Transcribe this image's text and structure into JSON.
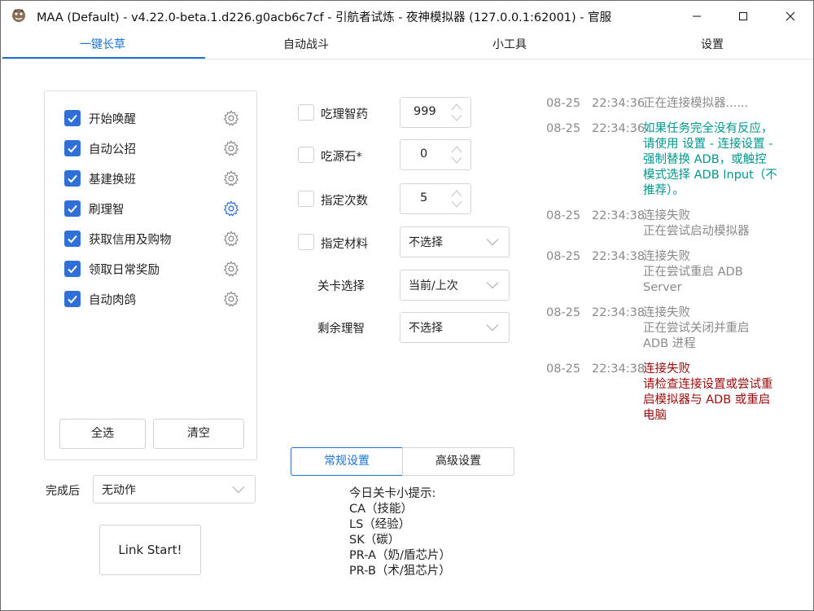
{
  "window": {
    "title": "MAA (Default) - v4.22.0-beta.1.d226.g0acb6c7cf - 引航者试炼 - 夜神模拟器 (127.0.0.1:62001) - 官服"
  },
  "tabs": [
    {
      "label": "一键长草",
      "active": true
    },
    {
      "label": "自动战斗",
      "active": false
    },
    {
      "label": "小工具",
      "active": false
    },
    {
      "label": "设置",
      "active": false
    }
  ],
  "tasks": {
    "items": [
      {
        "label": "开始唤醒",
        "checked": true,
        "gear_active": false
      },
      {
        "label": "自动公招",
        "checked": true,
        "gear_active": false
      },
      {
        "label": "基建换班",
        "checked": true,
        "gear_active": false
      },
      {
        "label": "刷理智",
        "checked": true,
        "gear_active": true
      },
      {
        "label": "获取信用及购物",
        "checked": true,
        "gear_active": false
      },
      {
        "label": "领取日常奖励",
        "checked": true,
        "gear_active": false
      },
      {
        "label": "自动肉鸽",
        "checked": true,
        "gear_active": false
      }
    ],
    "select_all_label": "全选",
    "clear_label": "清空"
  },
  "after_completion": {
    "label": "完成后",
    "value": "无动作"
  },
  "link_start_label": "Link Start!",
  "options": {
    "medicine": {
      "label": "吃理智药",
      "checked": false,
      "value": "999"
    },
    "stone": {
      "label": "吃源石*",
      "checked": false,
      "value": "0"
    },
    "times": {
      "label": "指定次数",
      "checked": false,
      "value": "5"
    },
    "material": {
      "label": "指定材料",
      "checked": false,
      "value": "不选择"
    },
    "stage": {
      "label": "关卡选择",
      "value": "当前/上次"
    },
    "remaining": {
      "label": "剩余理智",
      "value": "不选择"
    }
  },
  "settings_tabs": {
    "general": "常规设置",
    "advanced": "高级设置"
  },
  "tips": {
    "title": "今日关卡小提示:",
    "lines": [
      "CA（技能）",
      "LS（经验）",
      "SK（碳）",
      "PR-A（奶/盾芯片）",
      "PR-B（术/狙芯片）"
    ]
  },
  "log": [
    {
      "date": "08-25",
      "time": "22:34:36",
      "message": "正在连接模拟器......",
      "color": "#8a8a8a"
    },
    {
      "date": "08-25",
      "time": "22:34:36",
      "message": "如果任务完全没有反应，\n请使用 设置 - 连接设置 -\n强制替换 ADB，或触控\n模式选择 ADB Input（不\n推荐）。",
      "color": "#00968f"
    },
    {
      "date": "08-25",
      "time": "22:34:38",
      "message": "连接失败\n正在尝试启动模拟器",
      "color": "#8a8a8a"
    },
    {
      "date": "08-25",
      "time": "22:34:38",
      "message": "连接失败\n正在尝试重启 ADB\nServer",
      "color": "#8a8a8a"
    },
    {
      "date": "08-25",
      "time": "22:34:38",
      "message": "连接失败\n正在尝试关闭并重启\nADB 进程",
      "color": "#8a8a8a"
    },
    {
      "date": "08-25",
      "time": "22:34:38",
      "message": "连接失败\n请检查连接设置或尝试重\n启模拟器与 ADB 或重启\n电脑",
      "color": "#9b0a0a"
    }
  ],
  "colors": {
    "accent": "#1a73d9",
    "checkbox": "#2f6fd8",
    "log_info": "#8a8a8a",
    "log_hint": "#00968f",
    "log_error": "#9b0a0a"
  }
}
